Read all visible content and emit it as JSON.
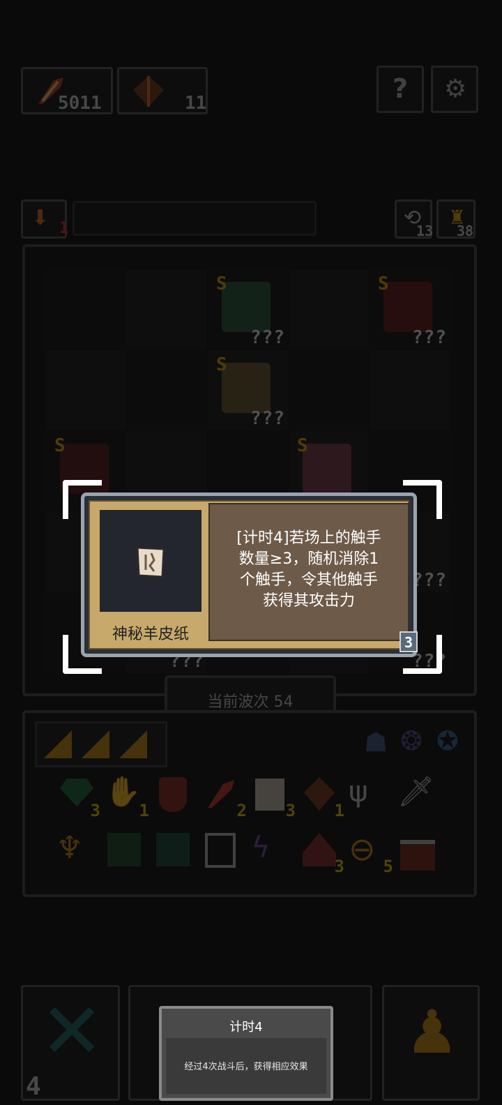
{
  "resources": {
    "gold": "5011",
    "gems": "11"
  },
  "level_bar": {
    "level": "1",
    "refresh_count": "13",
    "trophy_count": "38"
  },
  "board": {
    "units": [
      {
        "rank": "S",
        "hidden": "???"
      },
      {
        "rank": "S",
        "hidden": "???"
      },
      {
        "rank": "S",
        "hidden": "???"
      },
      {
        "rank": "S",
        "hidden": "???"
      },
      {
        "rank": "S",
        "hidden": "???"
      },
      {
        "rank": "",
        "hidden": "???"
      },
      {
        "rank": "",
        "hidden": "???"
      },
      {
        "rank": "",
        "hidden": "???"
      }
    ],
    "wave_label": "当前波次 54"
  },
  "inventory": {
    "counts": [
      "3",
      "1",
      "",
      "2",
      "3",
      "1",
      "",
      "",
      "",
      "",
      "",
      "",
      "",
      "3",
      "5",
      ""
    ]
  },
  "tooltip": {
    "item_name": "神秘羊皮纸",
    "description_lines": [
      "[计时4]若场上的触手",
      "数量≥3，随机消除1",
      "个触手，令其他触手",
      "获得其攻击力"
    ],
    "level": "3"
  },
  "keyword_popup": {
    "title": "计时4",
    "description": "经过4次战斗后，获得相应效果"
  },
  "bottom_bar": {
    "sell_count": "4"
  },
  "colors": {
    "accent_gold": "#e6a800",
    "panel_tan": "#c7a96b",
    "panel_brown": "#6d5a49"
  }
}
